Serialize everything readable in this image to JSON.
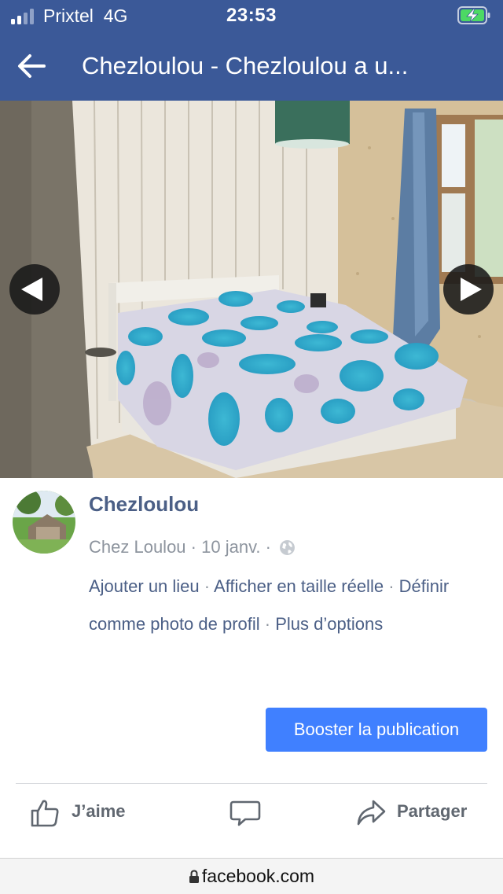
{
  "status_bar": {
    "carrier": "Prixtel",
    "network": "4G",
    "time": "23:53",
    "signal_bars_active": 2,
    "signal_bars_total": 4,
    "battery_icon": "battery-charging-icon"
  },
  "header": {
    "back_icon": "back-arrow-icon",
    "title": "Chezloulou - Chezloulou a u..."
  },
  "photo": {
    "prev_icon": "chevron-left-icon",
    "next_icon": "chevron-right-icon"
  },
  "post": {
    "author": "Chezloulou",
    "page_name": "Chez Loulou",
    "date": "10 janv.",
    "separator": "·",
    "audience_icon": "globe-icon",
    "actions": {
      "add_place": "Ajouter un lieu",
      "full_size": "Afficher en taille réelle",
      "set_profile": "Définir comme photo de profil",
      "more_options": "Plus d’options"
    },
    "boost_button": "Booster la publication"
  },
  "reactions": {
    "like": "J’aime",
    "comment_icon": "comment-icon",
    "share": "Partager"
  },
  "url_bar": {
    "url": "facebook.com"
  },
  "colors": {
    "brand_blue": "#3b5998",
    "boost_blue": "#4080ff",
    "link_color": "#4b5f86",
    "meta_gray": "#8d949e",
    "battery_green": "#4cd964"
  }
}
